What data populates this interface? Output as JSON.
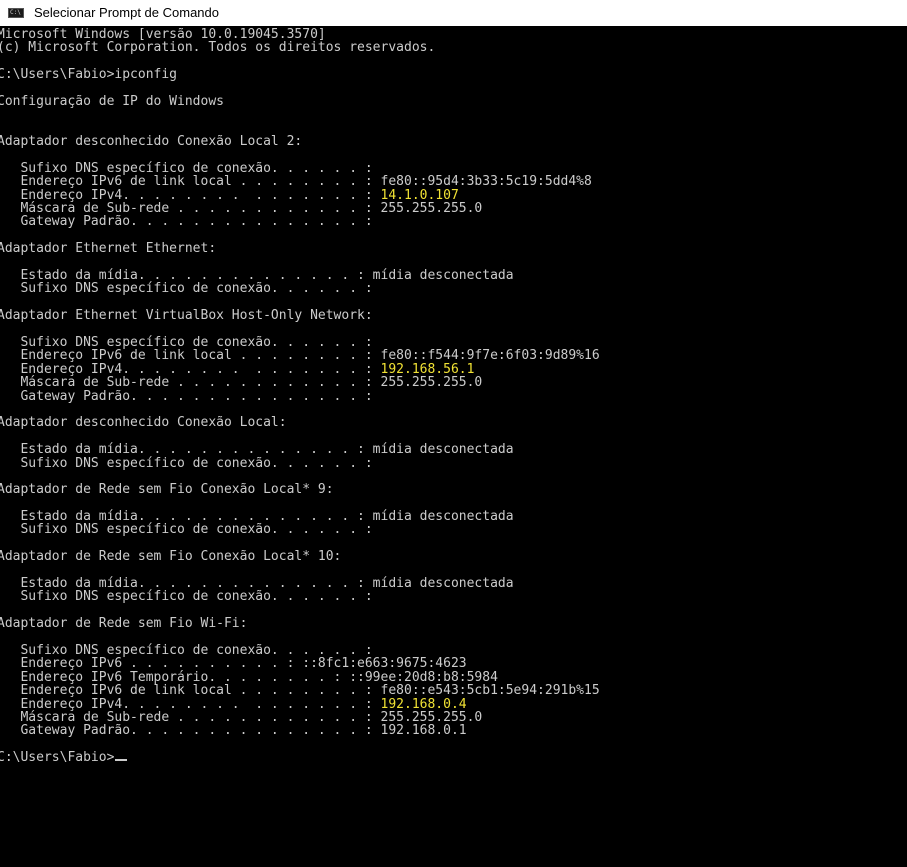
{
  "window": {
    "title": "Selecionar Prompt de Comando",
    "icon": "cmd-icon"
  },
  "console": {
    "lines": [
      {
        "t": "Microsoft Windows [versão 10.0.19045.3570]"
      },
      {
        "t": "(c) Microsoft Corporation. Todos os direitos reservados."
      },
      {
        "t": ""
      },
      {
        "t": "C:\\Users\\Fabio>ipconfig"
      },
      {
        "t": ""
      },
      {
        "t": "Configuração de IP do Windows"
      },
      {
        "t": ""
      },
      {
        "t": ""
      },
      {
        "t": "Adaptador desconhecido Conexão Local 2:"
      },
      {
        "t": ""
      },
      {
        "t": "   Sufixo DNS específico de conexão. . . . . . :"
      },
      {
        "t": "   Endereço IPv6 de link local . . . . . . . . : fe80::95d4:3b33:5c19:5dd4%8"
      },
      {
        "t": "   Endereço IPv4. . . . . . . .  . . . . . . . : ",
        "v": "14.1.0.107"
      },
      {
        "t": "   Máscara de Sub-rede . . . . . . . . . . . . : 255.255.255.0"
      },
      {
        "t": "   Gateway Padrão. . . . . . . . . . . . . . . :"
      },
      {
        "t": ""
      },
      {
        "t": "Adaptador Ethernet Ethernet:"
      },
      {
        "t": ""
      },
      {
        "t": "   Estado da mídia. . . . . . . . . . . . . . : mídia desconectada"
      },
      {
        "t": "   Sufixo DNS específico de conexão. . . . . . :"
      },
      {
        "t": ""
      },
      {
        "t": "Adaptador Ethernet VirtualBox Host-Only Network:"
      },
      {
        "t": ""
      },
      {
        "t": "   Sufixo DNS específico de conexão. . . . . . :"
      },
      {
        "t": "   Endereço IPv6 de link local . . . . . . . . : fe80::f544:9f7e:6f03:9d89%16"
      },
      {
        "t": "   Endereço IPv4. . . . . . . .  . . . . . . . : ",
        "v": "192.168.56.1"
      },
      {
        "t": "   Máscara de Sub-rede . . . . . . . . . . . . : 255.255.255.0"
      },
      {
        "t": "   Gateway Padrão. . . . . . . . . . . . . . . :"
      },
      {
        "t": ""
      },
      {
        "t": "Adaptador desconhecido Conexão Local:"
      },
      {
        "t": ""
      },
      {
        "t": "   Estado da mídia. . . . . . . . . . . . . . : mídia desconectada"
      },
      {
        "t": "   Sufixo DNS específico de conexão. . . . . . :"
      },
      {
        "t": ""
      },
      {
        "t": "Adaptador de Rede sem Fio Conexão Local* 9:"
      },
      {
        "t": ""
      },
      {
        "t": "   Estado da mídia. . . . . . . . . . . . . . : mídia desconectada"
      },
      {
        "t": "   Sufixo DNS específico de conexão. . . . . . :"
      },
      {
        "t": ""
      },
      {
        "t": "Adaptador de Rede sem Fio Conexão Local* 10:"
      },
      {
        "t": ""
      },
      {
        "t": "   Estado da mídia. . . . . . . . . . . . . . : mídia desconectada"
      },
      {
        "t": "   Sufixo DNS específico de conexão. . . . . . :"
      },
      {
        "t": ""
      },
      {
        "t": "Adaptador de Rede sem Fio Wi-Fi:"
      },
      {
        "t": ""
      },
      {
        "t": "   Sufixo DNS específico de conexão. . . . . . :"
      },
      {
        "t": "   Endereço IPv6 . . . . . . . . . . : ::8fc1:e663:9675:4623"
      },
      {
        "t": "   Endereço IPv6 Temporário. . . . . . . . : ::99ee:20d8:b8:5984"
      },
      {
        "t": "   Endereço IPv6 de link local . . . . . . . . : fe80::e543:5cb1:5e94:291b%15"
      },
      {
        "t": "   Endereço IPv4. . . . . . . .  . . . . . . . : ",
        "v": "192.168.0.4"
      },
      {
        "t": "   Máscara de Sub-rede . . . . . . . . . . . . : 255.255.255.0"
      },
      {
        "t": "   Gateway Padrão. . . . . . . . . . . . . . . : 192.168.0.1"
      },
      {
        "t": ""
      },
      {
        "t": "C:\\Users\\Fabio>",
        "cursor": true
      }
    ]
  },
  "colors": {
    "background": "#000000",
    "text": "#cccccc",
    "highlight": "#f1e234",
    "titlebar": "#ffffff"
  }
}
